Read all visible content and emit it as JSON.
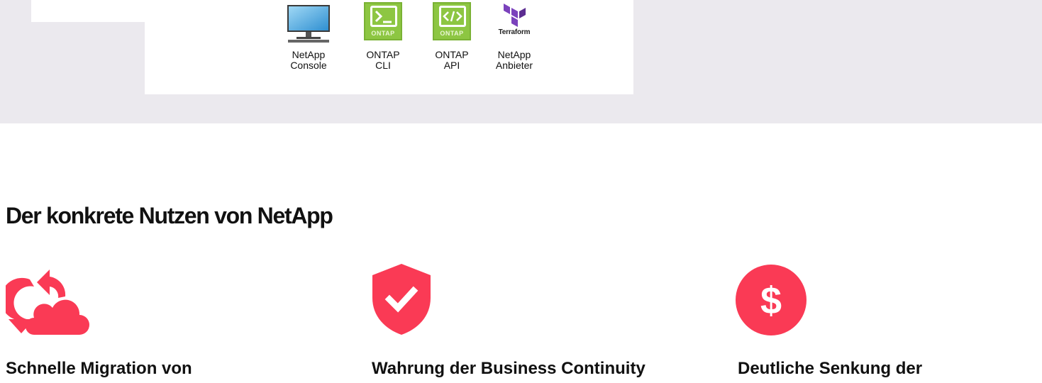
{
  "tools": [
    {
      "icon": "monitor-icon",
      "label_line1": "NetApp",
      "label_line2": "Console"
    },
    {
      "icon": "ontap-cli-icon",
      "badge": "ONTAP",
      "label_line1": "ONTAP",
      "label_line2": "CLI"
    },
    {
      "icon": "ontap-api-icon",
      "badge": "ONTAP",
      "label_line1": "ONTAP",
      "label_line2": "API"
    },
    {
      "icon": "terraform-icon",
      "logo_text": "Terraform",
      "label_line1": "NetApp",
      "label_line2": "Anbieter"
    }
  ],
  "section": {
    "title": "Der konkrete Nutzen von NetApp"
  },
  "benefits": [
    {
      "icon": "cloud-migration-icon",
      "title": "Schnelle Migration von"
    },
    {
      "icon": "shield-check-icon",
      "title": "Wahrung der Business Continuity"
    },
    {
      "icon": "dollar-circle-icon",
      "title": "Deutliche Senkung der"
    }
  ],
  "colors": {
    "accent": "#fa3a55",
    "band": "#ebe9ee",
    "ontap_green": "#8dc642",
    "terraform_purple": "#7b42bc"
  }
}
